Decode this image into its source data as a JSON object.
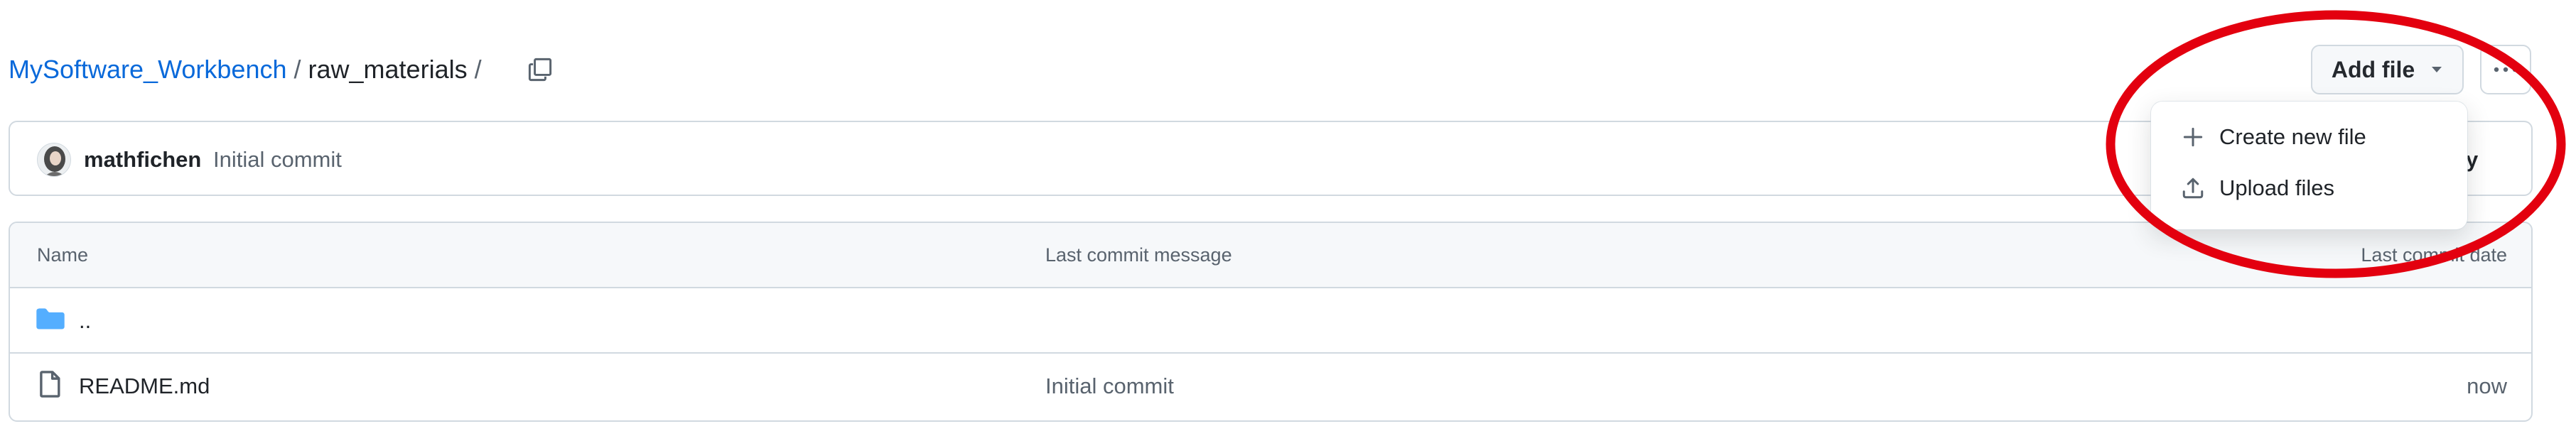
{
  "breadcrumb": {
    "repo": "MySoftware_Workbench",
    "separator": "/",
    "folder": "raw_materials",
    "trailing_separator": "/"
  },
  "toolbar": {
    "copy_icon": "copy-icon",
    "add_file_label": "Add file",
    "add_file_caret_icon": "triangle-down-icon",
    "more_icon": "kebab-horizontal-icon"
  },
  "latest_commit": {
    "author": "mathfichen",
    "message": "Initial commit",
    "history_fragment": "ory"
  },
  "file_table": {
    "headers": {
      "name": "Name",
      "message": "Last commit message",
      "date": "Last commit date"
    },
    "rows": [
      {
        "icon": "folder-icon",
        "name": "..",
        "message": "",
        "date": ""
      },
      {
        "icon": "file-icon",
        "name": "README.md",
        "message": "Initial commit",
        "date": "now"
      }
    ]
  },
  "add_file_menu": {
    "items": [
      {
        "icon": "plus-icon",
        "label": "Create new file"
      },
      {
        "icon": "upload-icon",
        "label": "Upload files"
      }
    ]
  },
  "colors": {
    "link": "#0969da",
    "border": "#d1d9e0",
    "muted_text": "#59636e",
    "folder_icon": "#54aeff",
    "annotation": "#e3000f"
  }
}
